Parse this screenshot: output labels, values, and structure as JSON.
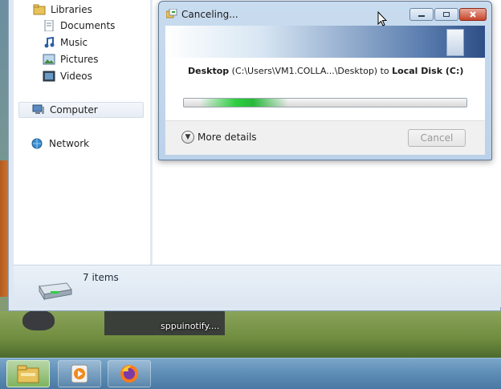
{
  "explorer": {
    "nav": {
      "libraries": "Libraries",
      "documents": "Documents",
      "music": "Music",
      "pictures": "Pictures",
      "videos": "Videos",
      "computer": "Computer",
      "network": "Network"
    },
    "status": {
      "items_count": "7 items"
    }
  },
  "dialog": {
    "title": "Canceling...",
    "source_name": "Desktop",
    "source_path": "(C:\\Users\\VM1.COLLA...\\Desktop)",
    "to_word": "to",
    "destination": "Local Disk (C:)",
    "more_details": "More details",
    "cancel": "Cancel",
    "progress_state": "indeterminate"
  },
  "desktop": {
    "label": "sppuinotify...."
  },
  "taskbar": {
    "apps": [
      "explorer-icon",
      "media-player-icon",
      "firefox-icon"
    ]
  },
  "colors": {
    "progress_green": "#2fcf42",
    "taskbar_blue": "#5f8eb6",
    "dialog_frame": "#c9dcef"
  }
}
